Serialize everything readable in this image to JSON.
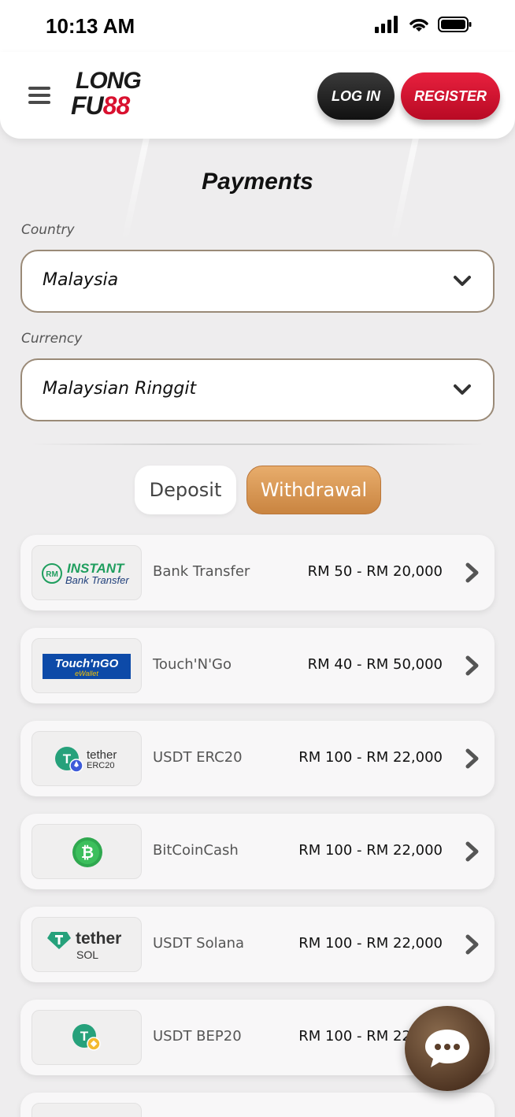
{
  "status_bar": {
    "time": "10:13 AM",
    "icons": [
      "signal-icon",
      "wifi-icon",
      "battery-icon"
    ]
  },
  "header": {
    "menu_icon": "hamburger-menu-icon",
    "logo_line1": "LONG",
    "logo_line2a": "FU",
    "logo_line2b": "88",
    "login_label": "LOG IN",
    "register_label": "REGISTER"
  },
  "page": {
    "title": "Payments",
    "country_label": "Country",
    "country_value": "Malaysia",
    "currency_label": "Currency",
    "currency_value": "Malaysian Ringgit"
  },
  "tabs": {
    "deposit": "Deposit",
    "withdrawal": "Withdrawal",
    "active": "withdrawal"
  },
  "methods": [
    {
      "logo_text_1": "INSTANT",
      "logo_text_2": "Bank Transfer",
      "logo_badge": "RM",
      "name": "Bank Transfer",
      "range": "RM 50 - RM 20,000"
    },
    {
      "logo_text_1": "Touch'nGO",
      "logo_text_2": "eWallet",
      "name": "Touch'N'Go",
      "range": "RM 40 - RM 50,000"
    },
    {
      "logo_text_1": "tether",
      "logo_text_2": "ERC20",
      "name": "USDT ERC20",
      "range": "RM 100 - RM 22,000"
    },
    {
      "name": "BitCoinCash",
      "range": "RM 100 - RM 22,000"
    },
    {
      "logo_text_1": "tether",
      "logo_text_2": "SOL",
      "name": "USDT Solana",
      "range": "RM 100 - RM 22,000"
    },
    {
      "name": "USDT BEP20",
      "range": "RM 100 - RM 22,000"
    }
  ],
  "colors": {
    "accent_gold": "#c98440",
    "register_red": "#d9112f",
    "tether_green": "#26a17b",
    "bitcoin_cash_green": "#2fa84f"
  },
  "chat_icon": "chat-bubble-icon"
}
